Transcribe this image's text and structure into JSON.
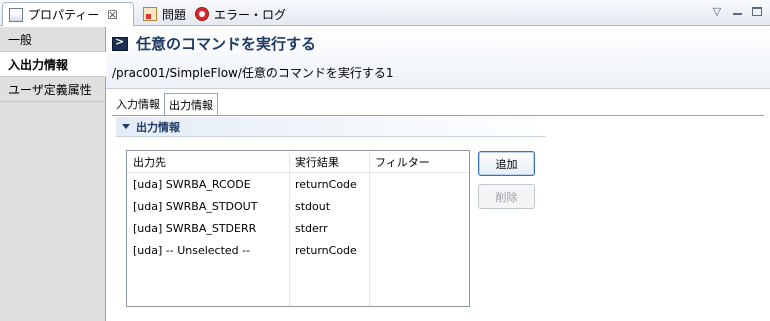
{
  "view_tabs": [
    {
      "label": "プロパティー",
      "icon": "properties-icon",
      "active": true
    },
    {
      "label": "問題",
      "icon": "problems-icon",
      "active": false
    },
    {
      "label": "エラー・ログ",
      "icon": "error-log-icon",
      "active": false
    }
  ],
  "view_tab_close": "☒",
  "window_controls": {
    "menu_glyph": "▽"
  },
  "sidebar": {
    "items": [
      {
        "label": "一般",
        "selected": false
      },
      {
        "label": "入出力情報",
        "selected": true
      },
      {
        "label": "ユーザ定義属性",
        "selected": false
      }
    ]
  },
  "header": {
    "title": "任意のコマンドを実行する",
    "path": "/prac001/SimpleFlow/任意のコマンドを実行する1"
  },
  "subtabs": [
    {
      "label": "入力情報",
      "active": false
    },
    {
      "label": "出力情報",
      "active": true
    }
  ],
  "section": {
    "title": "出力情報",
    "expanded": true
  },
  "table": {
    "columns": [
      "出力先",
      "実行結果",
      "フィルター"
    ],
    "rows": [
      [
        "[uda] SWRBA_RCODE",
        "returnCode",
        ""
      ],
      [
        "[uda] SWRBA_STDOUT",
        "stdout",
        ""
      ],
      [
        "[uda] SWRBA_STDERR",
        "stderr",
        ""
      ],
      [
        "[uda] -- Unselected --",
        "returnCode",
        ""
      ]
    ]
  },
  "buttons": {
    "add": "追加",
    "delete": "削除",
    "delete_enabled": false
  },
  "colors": {
    "accent": "#1f3a63",
    "button_border": "#3b6fb6",
    "sidebar_bg": "#dfdfdf"
  }
}
